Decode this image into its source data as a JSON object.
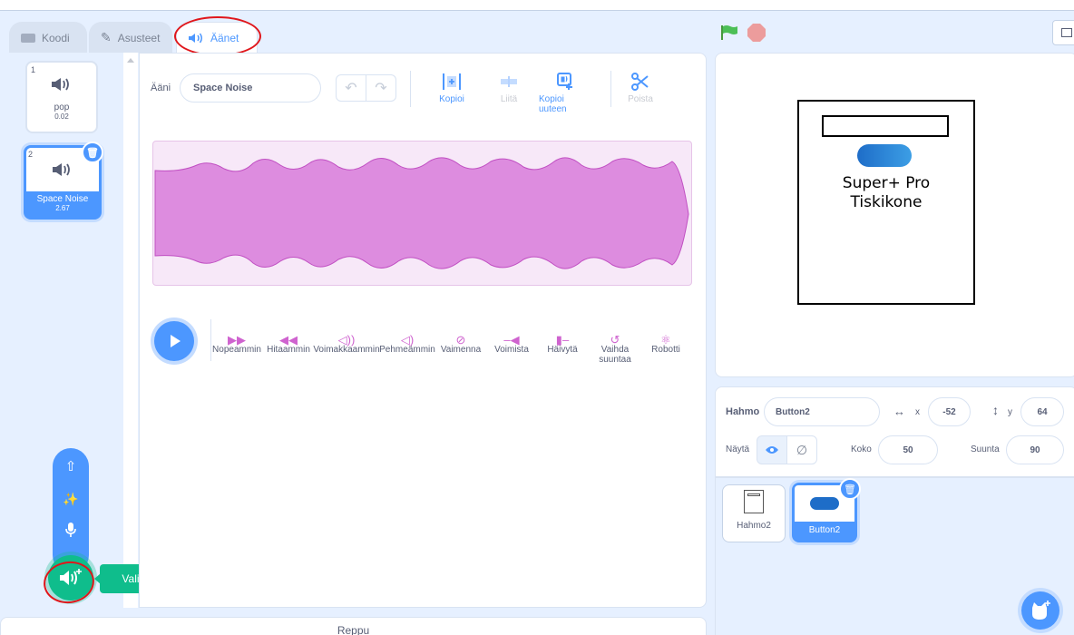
{
  "tabs": [
    {
      "label": "Koodi"
    },
    {
      "label": "Asusteet"
    },
    {
      "label": "Äänet"
    }
  ],
  "sounds": [
    {
      "number": "1",
      "name": "pop",
      "duration": "0.02"
    },
    {
      "number": "2",
      "name": "Space Noise",
      "duration": "2.67"
    }
  ],
  "editor": {
    "sound_label": "Ääni",
    "sound_name": "Space Noise",
    "tools": {
      "copy": "Kopioi",
      "paste": "Liitä",
      "copy_new": "Kopioi uuteen",
      "delete": "Poista"
    },
    "effects": {
      "faster": "Nopeammin",
      "slower": "Hitaammin",
      "louder": "Voimakkaammin",
      "softer": "Pehmeämmin",
      "mute": "Vaimenna",
      "fade_in": "Voimista",
      "fade_out": "Häivytä",
      "reverse_1": "Vaihda",
      "reverse_2": "suuntaa",
      "robot": "Robotti"
    },
    "waveform_color": "#d98fdb"
  },
  "stage": {
    "title_line1": "Super+ Pro",
    "title_line2": "Tiskikone"
  },
  "sprite_info": {
    "sprite_label": "Hahmo",
    "sprite_name": "Button2",
    "x_label": "x",
    "x_value": "-52",
    "y_label": "y",
    "y_value": "64",
    "show_label": "Näytä",
    "size_label": "Koko",
    "size_value": "50",
    "direction_label": "Suunta",
    "direction_value": "90"
  },
  "sprites": [
    {
      "name": "Hahmo2"
    },
    {
      "name": "Button2"
    }
  ],
  "tooltip": "Valitse ääni",
  "backpack": "Reppu",
  "colors": {
    "accent": "#4c97ff",
    "sound": "#cf63cf",
    "green": "#0fbd8c",
    "annotation": "#e0161b"
  }
}
